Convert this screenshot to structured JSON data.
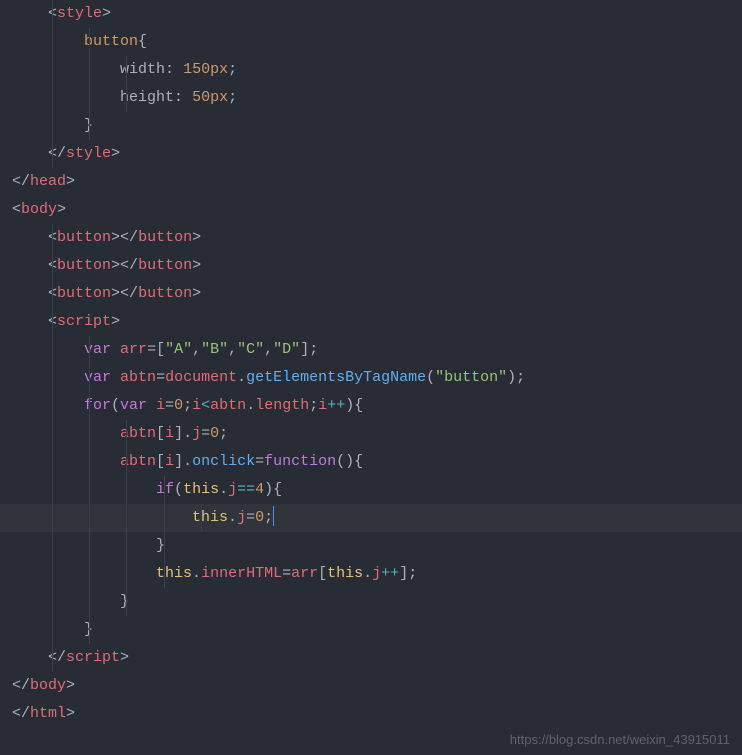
{
  "code": {
    "lines": [
      {
        "indent": 1,
        "tokens": [
          {
            "t": "<",
            "c": "bracket"
          },
          {
            "t": "style",
            "c": "tag"
          },
          {
            "t": ">",
            "c": "bracket"
          }
        ]
      },
      {
        "indent": 2,
        "tokens": [
          {
            "t": "button",
            "c": "selector"
          },
          {
            "t": "{",
            "c": "punct"
          }
        ]
      },
      {
        "indent": 3,
        "tokens": [
          {
            "t": "width",
            "c": "property"
          },
          {
            "t": ": ",
            "c": "punct"
          },
          {
            "t": "150px",
            "c": "value"
          },
          {
            "t": ";",
            "c": "punct"
          }
        ]
      },
      {
        "indent": 3,
        "tokens": [
          {
            "t": "height",
            "c": "property"
          },
          {
            "t": ": ",
            "c": "punct"
          },
          {
            "t": "50px",
            "c": "value"
          },
          {
            "t": ";",
            "c": "punct"
          }
        ]
      },
      {
        "indent": 2,
        "tokens": [
          {
            "t": "}",
            "c": "punct"
          }
        ]
      },
      {
        "indent": 1,
        "tokens": [
          {
            "t": "</",
            "c": "bracket"
          },
          {
            "t": "style",
            "c": "tag"
          },
          {
            "t": ">",
            "c": "bracket"
          }
        ]
      },
      {
        "indent": 0,
        "tokens": [
          {
            "t": "</",
            "c": "bracket"
          },
          {
            "t": "head",
            "c": "tag"
          },
          {
            "t": ">",
            "c": "bracket"
          }
        ]
      },
      {
        "indent": 0,
        "tokens": [
          {
            "t": "<",
            "c": "bracket"
          },
          {
            "t": "body",
            "c": "tag"
          },
          {
            "t": ">",
            "c": "bracket"
          }
        ]
      },
      {
        "indent": 1,
        "tokens": [
          {
            "t": "<",
            "c": "bracket"
          },
          {
            "t": "button",
            "c": "tag"
          },
          {
            "t": "></",
            "c": "bracket"
          },
          {
            "t": "button",
            "c": "tag"
          },
          {
            "t": ">",
            "c": "bracket"
          }
        ]
      },
      {
        "indent": 1,
        "tokens": [
          {
            "t": "<",
            "c": "bracket"
          },
          {
            "t": "button",
            "c": "tag"
          },
          {
            "t": "></",
            "c": "bracket"
          },
          {
            "t": "button",
            "c": "tag"
          },
          {
            "t": ">",
            "c": "bracket"
          }
        ]
      },
      {
        "indent": 1,
        "tokens": [
          {
            "t": "<",
            "c": "bracket"
          },
          {
            "t": "button",
            "c": "tag"
          },
          {
            "t": "></",
            "c": "bracket"
          },
          {
            "t": "button",
            "c": "tag"
          },
          {
            "t": ">",
            "c": "bracket"
          }
        ]
      },
      {
        "indent": 1,
        "tokens": [
          {
            "t": "<",
            "c": "bracket"
          },
          {
            "t": "script",
            "c": "tag"
          },
          {
            "t": ">",
            "c": "bracket"
          }
        ]
      },
      {
        "indent": 2,
        "tokens": [
          {
            "t": "var",
            "c": "keyword"
          },
          {
            "t": " ",
            "c": "punct"
          },
          {
            "t": "arr",
            "c": "variable"
          },
          {
            "t": "=[",
            "c": "punct"
          },
          {
            "t": "\"A\"",
            "c": "string"
          },
          {
            "t": ",",
            "c": "punct"
          },
          {
            "t": "\"B\"",
            "c": "string"
          },
          {
            "t": ",",
            "c": "punct"
          },
          {
            "t": "\"C\"",
            "c": "string"
          },
          {
            "t": ",",
            "c": "punct"
          },
          {
            "t": "\"D\"",
            "c": "string"
          },
          {
            "t": "];",
            "c": "punct"
          }
        ]
      },
      {
        "indent": 2,
        "tokens": [
          {
            "t": "var",
            "c": "keyword"
          },
          {
            "t": " ",
            "c": "punct"
          },
          {
            "t": "abtn",
            "c": "variable"
          },
          {
            "t": "=",
            "c": "punct"
          },
          {
            "t": "document",
            "c": "variable"
          },
          {
            "t": ".",
            "c": "punct"
          },
          {
            "t": "getElementsByTagName",
            "c": "func"
          },
          {
            "t": "(",
            "c": "punct"
          },
          {
            "t": "\"button\"",
            "c": "string"
          },
          {
            "t": ");",
            "c": "punct"
          }
        ]
      },
      {
        "indent": 2,
        "tokens": [
          {
            "t": "for",
            "c": "keyword"
          },
          {
            "t": "(",
            "c": "punct"
          },
          {
            "t": "var",
            "c": "keyword"
          },
          {
            "t": " ",
            "c": "punct"
          },
          {
            "t": "i",
            "c": "variable"
          },
          {
            "t": "=",
            "c": "punct"
          },
          {
            "t": "0",
            "c": "number"
          },
          {
            "t": ";",
            "c": "punct"
          },
          {
            "t": "i",
            "c": "variable"
          },
          {
            "t": "<",
            "c": "operator"
          },
          {
            "t": "abtn",
            "c": "variable"
          },
          {
            "t": ".",
            "c": "punct"
          },
          {
            "t": "length",
            "c": "variable"
          },
          {
            "t": ";",
            "c": "punct"
          },
          {
            "t": "i",
            "c": "variable"
          },
          {
            "t": "++",
            "c": "operator"
          },
          {
            "t": "){",
            "c": "punct"
          }
        ]
      },
      {
        "indent": 3,
        "tokens": [
          {
            "t": "abtn",
            "c": "variable"
          },
          {
            "t": "[",
            "c": "punct"
          },
          {
            "t": "i",
            "c": "variable"
          },
          {
            "t": "].",
            "c": "punct"
          },
          {
            "t": "j",
            "c": "variable"
          },
          {
            "t": "=",
            "c": "punct"
          },
          {
            "t": "0",
            "c": "number"
          },
          {
            "t": ";",
            "c": "punct"
          }
        ]
      },
      {
        "indent": 3,
        "tokens": [
          {
            "t": "abtn",
            "c": "variable"
          },
          {
            "t": "[",
            "c": "punct"
          },
          {
            "t": "i",
            "c": "variable"
          },
          {
            "t": "].",
            "c": "punct"
          },
          {
            "t": "onclick",
            "c": "func"
          },
          {
            "t": "=",
            "c": "punct"
          },
          {
            "t": "function",
            "c": "keyword"
          },
          {
            "t": "(){",
            "c": "punct"
          }
        ]
      },
      {
        "indent": 4,
        "tokens": [
          {
            "t": "if",
            "c": "keyword"
          },
          {
            "t": "(",
            "c": "punct"
          },
          {
            "t": "this",
            "c": "this"
          },
          {
            "t": ".",
            "c": "punct"
          },
          {
            "t": "j",
            "c": "variable"
          },
          {
            "t": "==",
            "c": "operator"
          },
          {
            "t": "4",
            "c": "number"
          },
          {
            "t": "){",
            "c": "punct"
          }
        ]
      },
      {
        "indent": 5,
        "highlighted": true,
        "cursor": true,
        "tokens": [
          {
            "t": "this",
            "c": "this"
          },
          {
            "t": ".",
            "c": "punct"
          },
          {
            "t": "j",
            "c": "variable"
          },
          {
            "t": "=",
            "c": "punct"
          },
          {
            "t": "0",
            "c": "number"
          },
          {
            "t": ";",
            "c": "punct"
          }
        ]
      },
      {
        "indent": 4,
        "tokens": [
          {
            "t": "}",
            "c": "punct"
          }
        ]
      },
      {
        "indent": 4,
        "tokens": [
          {
            "t": "this",
            "c": "this"
          },
          {
            "t": ".",
            "c": "punct"
          },
          {
            "t": "innerHTML",
            "c": "variable"
          },
          {
            "t": "=",
            "c": "punct"
          },
          {
            "t": "arr",
            "c": "variable"
          },
          {
            "t": "[",
            "c": "punct"
          },
          {
            "t": "this",
            "c": "this"
          },
          {
            "t": ".",
            "c": "punct"
          },
          {
            "t": "j",
            "c": "variable"
          },
          {
            "t": "++",
            "c": "operator"
          },
          {
            "t": "];",
            "c": "punct"
          }
        ]
      },
      {
        "indent": 3,
        "tokens": [
          {
            "t": "}",
            "c": "punct"
          }
        ]
      },
      {
        "indent": 2,
        "tokens": [
          {
            "t": "}",
            "c": "punct"
          }
        ]
      },
      {
        "indent": 1,
        "tokens": [
          {
            "t": "</",
            "c": "bracket"
          },
          {
            "t": "script",
            "c": "tag"
          },
          {
            "t": ">",
            "c": "bracket"
          }
        ]
      },
      {
        "indent": 0,
        "tokens": [
          {
            "t": "</",
            "c": "bracket"
          },
          {
            "t": "body",
            "c": "tag"
          },
          {
            "t": ">",
            "c": "bracket"
          }
        ]
      },
      {
        "indent": 0,
        "tokens": [
          {
            "t": "</",
            "c": "bracket"
          },
          {
            "t": "html",
            "c": "tag"
          },
          {
            "t": ">",
            "c": "bracket"
          }
        ]
      }
    ]
  },
  "watermark": "https://blog.csdn.net/weixin_43915011"
}
